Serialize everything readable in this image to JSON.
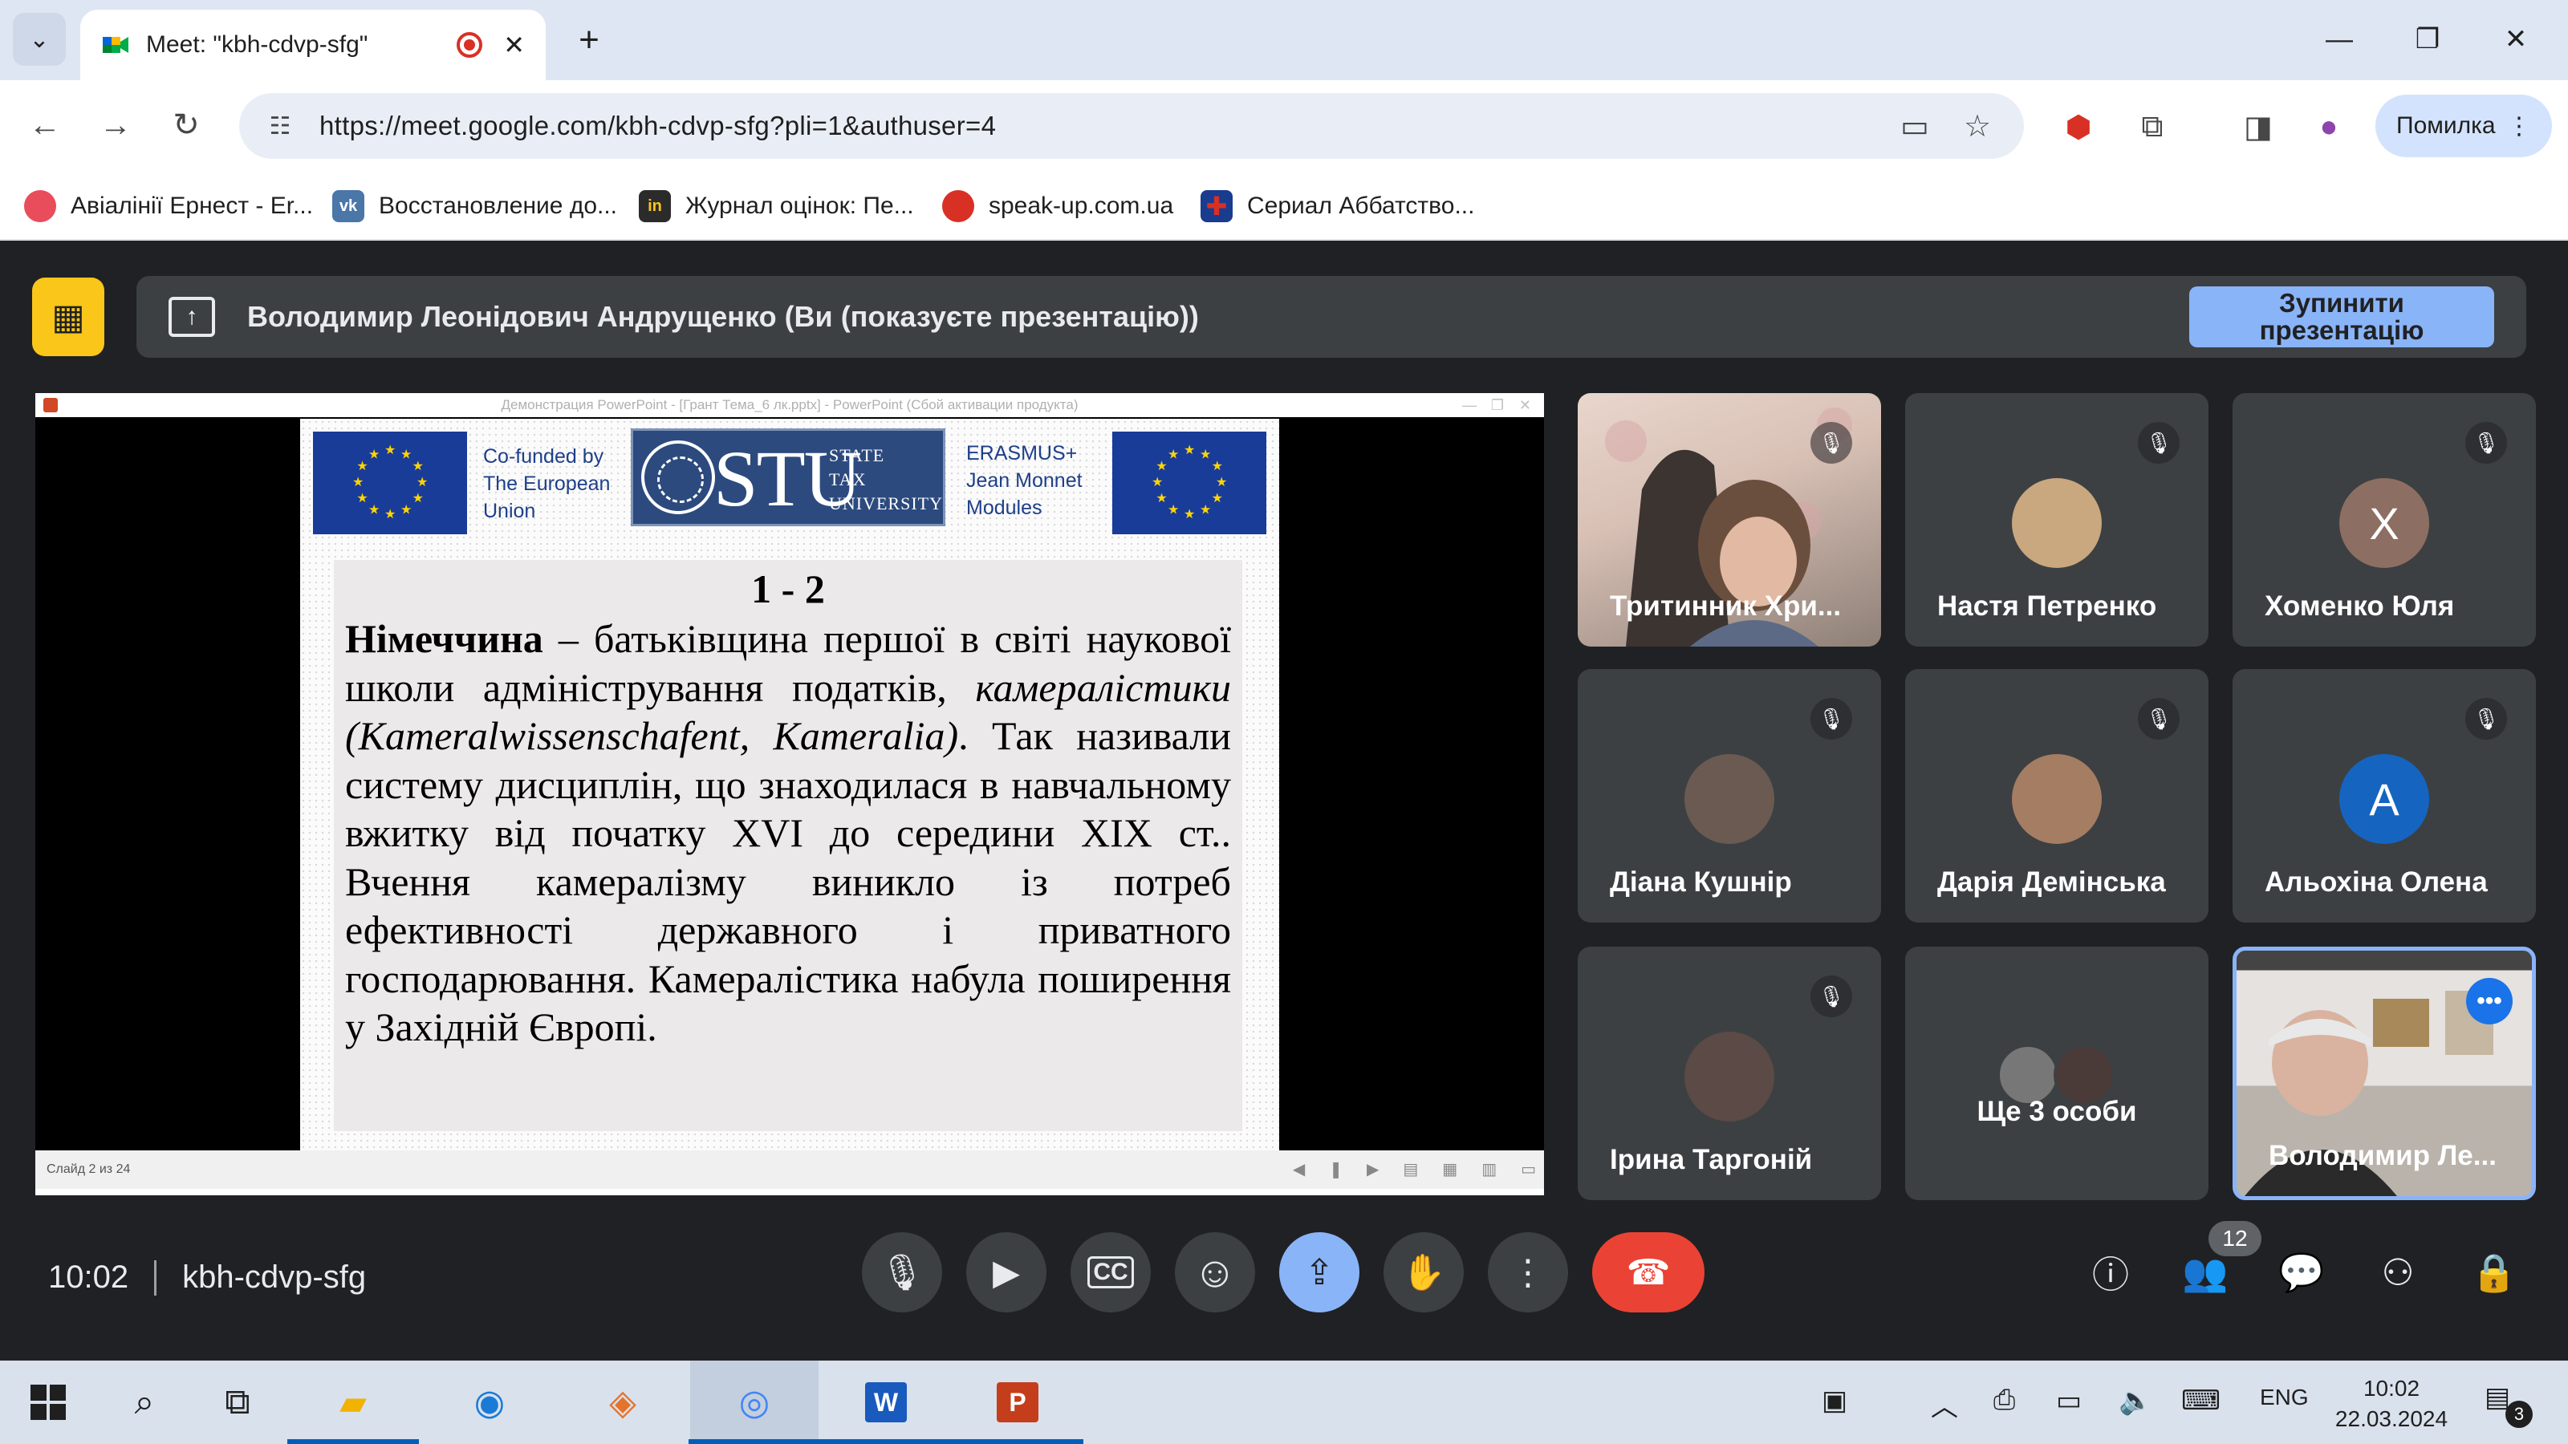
{
  "browser": {
    "tab_title": "Meet: \"kbh-cdvp-sfg\"",
    "new_tab_glyph": "+",
    "url": "https://meet.google.com/kbh-cdvp-sfg?pli=1&authuser=4",
    "profile_label": "Помилка",
    "bookmarks": [
      {
        "label": "Авіалінії Ернест - Er...",
        "color": "#e94c5a"
      },
      {
        "label": "Восстановление до...",
        "color": "#4a76a8"
      },
      {
        "label": "Журнал оцінок: Пе...",
        "color": "#2b2b2b"
      },
      {
        "label": "speak-up.com.ua",
        "color": "#d93025"
      },
      {
        "label": "Сериал Аббатство...",
        "color": "#1a3c8e"
      }
    ]
  },
  "meet": {
    "banner_text": "Володимир Леонідович Андрущенко (Ви (показуєте презентацію))",
    "stop_button": "Зупинити\nпрезентацію",
    "powerpoint": {
      "window_title": "Демонстрация PowerPoint - [Грант Тема_6 лк.pptx] - PowerPoint (Сбой активации продукта)",
      "status": "Слайд 2 из 24"
    },
    "slide": {
      "cofunded": [
        "Co-funded by",
        "The European",
        "Union"
      ],
      "stu_big": "STU",
      "stu_small": [
        "STATE",
        "TAX",
        "UNIVERSITY"
      ],
      "erasmus": [
        "ERASMUS+",
        "Jean Monnet",
        "Modules"
      ],
      "heading": "1 - 2",
      "bold_word": "Німеччина",
      "text_1": " – батьківщина першої в світі наукової школи адміністрування податків, ",
      "italic_1": "камералістики (Kameralwissenschafent, Kameralia)",
      "text_2": ". Так називали систему дисциплін, що знаходилася в навчальному  вжитку від початку XVI до середини XIX ст.. Вчення камералізму виникло із потреб ефективності державного і приватного господарювання. Камералістика набула поширення у Західній Європі."
    },
    "participants": [
      {
        "name": "Тритинник Хри...",
        "type": "video",
        "muted": true
      },
      {
        "name": "Настя Петренко",
        "type": "photo",
        "muted": true,
        "color": "#c9a77f"
      },
      {
        "name": "Хоменко Юля",
        "type": "initial",
        "initial": "Х",
        "muted": true,
        "color": "#8d6e63"
      },
      {
        "name": "Діана Кушнір",
        "type": "photo",
        "muted": true,
        "color": "#6b5a52"
      },
      {
        "name": "Дарія Демінська",
        "type": "photo",
        "muted": true,
        "color": "#a57d62"
      },
      {
        "name": "Альохіна Олена",
        "type": "initial",
        "initial": "A",
        "muted": true,
        "color": "#1565c0"
      },
      {
        "name": "Ірина Таргоній",
        "type": "photo",
        "muted": true,
        "color": "#5b4a45"
      },
      {
        "name": "Ще 3 особи",
        "type": "others"
      },
      {
        "name": "Володимир Ле...",
        "type": "self"
      }
    ],
    "time": "10:02",
    "meeting_code": "kbh-cdvp-sfg",
    "participant_count": "12"
  },
  "taskbar": {
    "language": "ENG",
    "time": "10:02",
    "date": "22.03.2024",
    "notifications": "3"
  },
  "icons": {
    "mic": "🎤",
    "cam": "📹",
    "cc": "CC",
    "emoji": "☺",
    "present": "⇪",
    "hand": "✋",
    "more": "⋮",
    "end": "☎",
    "info": "ⓘ",
    "people": "👥",
    "chat": "💬",
    "activities": "⚇",
    "lock": "🔒"
  }
}
